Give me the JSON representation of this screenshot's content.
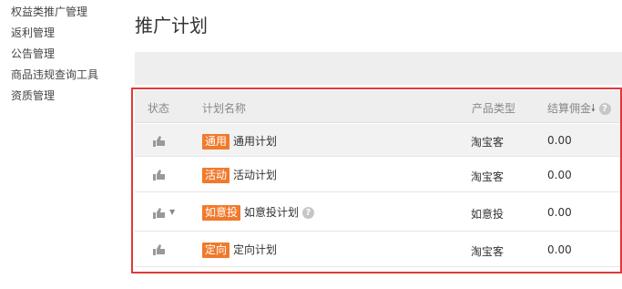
{
  "sidebar": {
    "items": [
      {
        "label": "权益类推广管理"
      },
      {
        "label": "返利管理"
      },
      {
        "label": "公告管理"
      },
      {
        "label": "商品违规查询工具"
      },
      {
        "label": "资质管理"
      }
    ]
  },
  "page_title": "推广计划",
  "table": {
    "headers": {
      "status": "状态",
      "plan_name": "计划名称",
      "product_type": "产品类型",
      "commission": "结算佣金"
    },
    "rows": [
      {
        "tag": "通用",
        "name": "通用计划",
        "product_type": "淘宝客",
        "commission": "0.00"
      },
      {
        "tag": "活动",
        "name": "活动计划",
        "product_type": "淘宝客",
        "commission": "0.00"
      },
      {
        "tag": "如意投",
        "name": "如意投计划",
        "product_type": "如意投",
        "commission": "0.00"
      },
      {
        "tag": "定向",
        "name": "定向计划",
        "product_type": "淘宝客",
        "commission": "0.00"
      }
    ]
  },
  "colors": {
    "accent_tag": "#f07a2c",
    "highlight_border": "#e03a3a"
  },
  "icons": {
    "status": "thumbs-up-icon",
    "sort": "sort-down-icon",
    "help": "question-circle-icon",
    "dropdown": "caret-down-icon"
  }
}
